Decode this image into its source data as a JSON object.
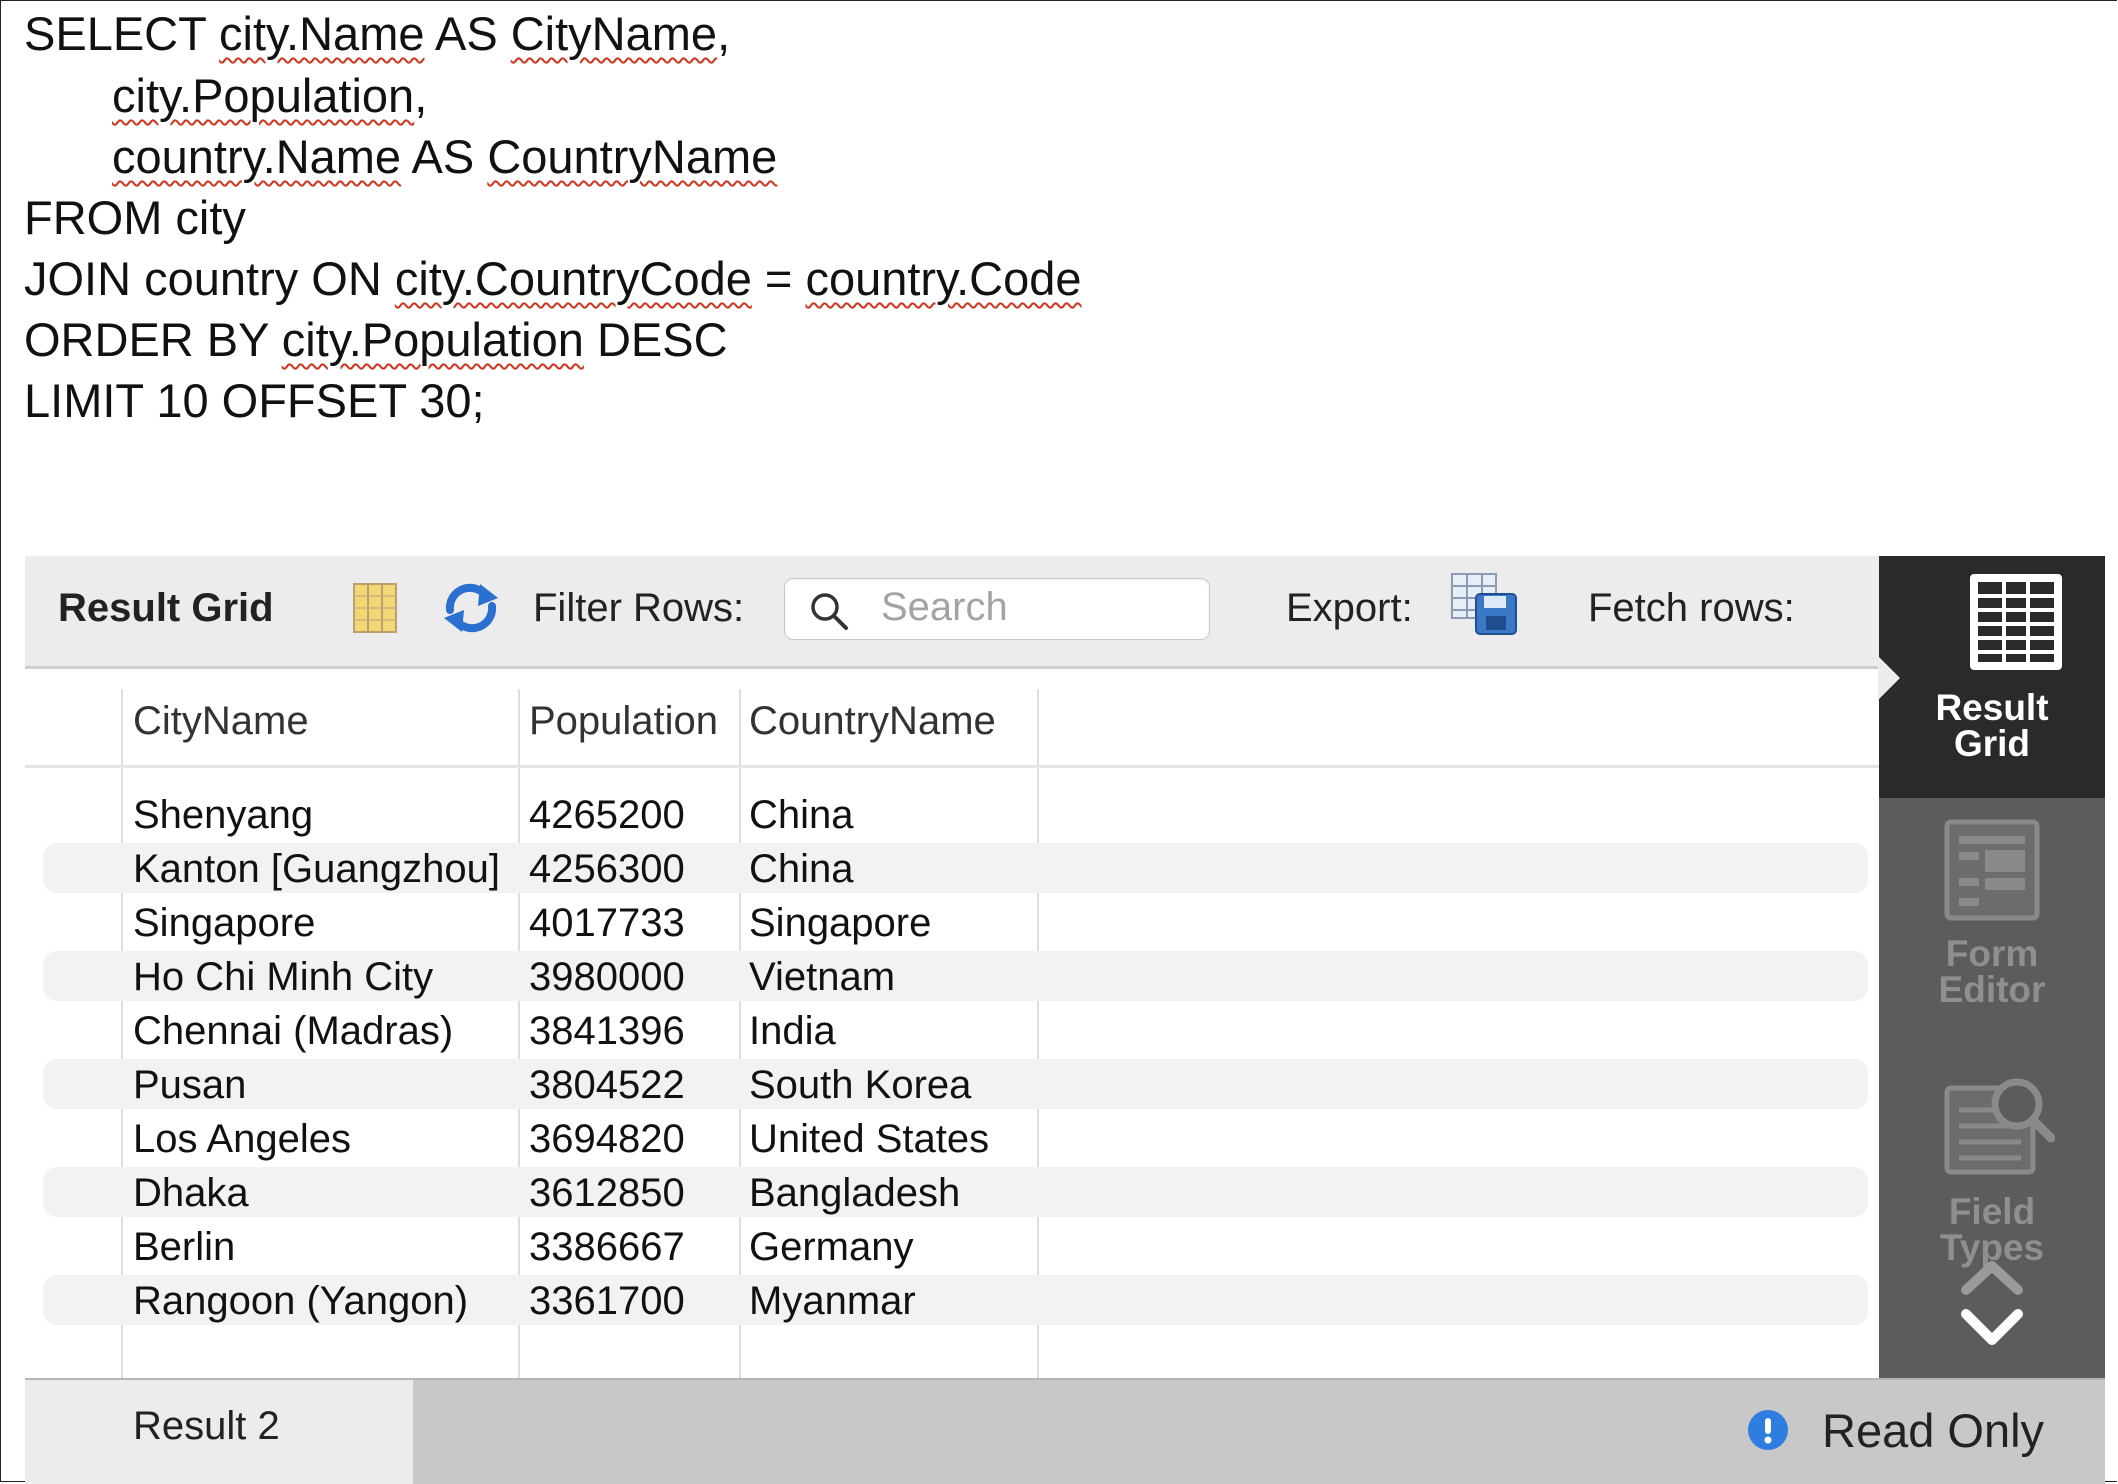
{
  "sql": {
    "line1_kw": "SELECT ",
    "line1_a": "city.Name",
    "line1_b": " AS ",
    "line1_c": "CityName",
    "line1_d": ",",
    "line2_a": "city.Population",
    "line2_b": ",",
    "line3_a": "country.Name",
    "line3_b": " AS ",
    "line3_c": "CountryName",
    "line4": "FROM city",
    "line5_a": "JOIN country ON ",
    "line5_b": "city.CountryCode",
    "line5_c": " = ",
    "line5_d": "country.Code",
    "line6_a": "ORDER BY ",
    "line6_b": "city.Population",
    "line6_c": " DESC",
    "line7": "LIMIT 10 OFFSET 30;"
  },
  "toolbar": {
    "title": "Result Grid",
    "filter_label": "Filter Rows:",
    "search_placeholder": "Search",
    "export_label": "Export:",
    "fetch_label": "Fetch rows:"
  },
  "grid": {
    "columns": [
      "CityName",
      "Population",
      "CountryName"
    ],
    "rows": [
      [
        "Shenyang",
        "4265200",
        "China"
      ],
      [
        "Kanton [Guangzhou]",
        "4256300",
        "China"
      ],
      [
        "Singapore",
        "4017733",
        "Singapore"
      ],
      [
        "Ho Chi Minh City",
        "3980000",
        "Vietnam"
      ],
      [
        "Chennai (Madras)",
        "3841396",
        "India"
      ],
      [
        "Pusan",
        "3804522",
        "South Korea"
      ],
      [
        "Los Angeles",
        "3694820",
        "United States"
      ],
      [
        "Dhaka",
        "3612850",
        "Bangladesh"
      ],
      [
        "Berlin",
        "3386667",
        "Germany"
      ],
      [
        "Rangoon (Yangon)",
        "3361700",
        "Myanmar"
      ]
    ]
  },
  "sidebar": {
    "items": [
      {
        "label_1": "Result",
        "label_2": "Grid",
        "icon": "result-grid-icon",
        "active": true
      },
      {
        "label_1": "Form",
        "label_2": "Editor",
        "icon": "form-editor-icon",
        "active": false
      },
      {
        "label_1": "Field",
        "label_2": "Types",
        "icon": "field-types-icon",
        "active": false
      }
    ]
  },
  "bottom": {
    "tab_label": "Result 2",
    "status": "Read Only"
  },
  "colors": {
    "squiggle": "#d0341f",
    "sidebar_active": "#2a2a2a",
    "sidebar": "#5c5c5c",
    "info_icon": "#2f7de1"
  }
}
